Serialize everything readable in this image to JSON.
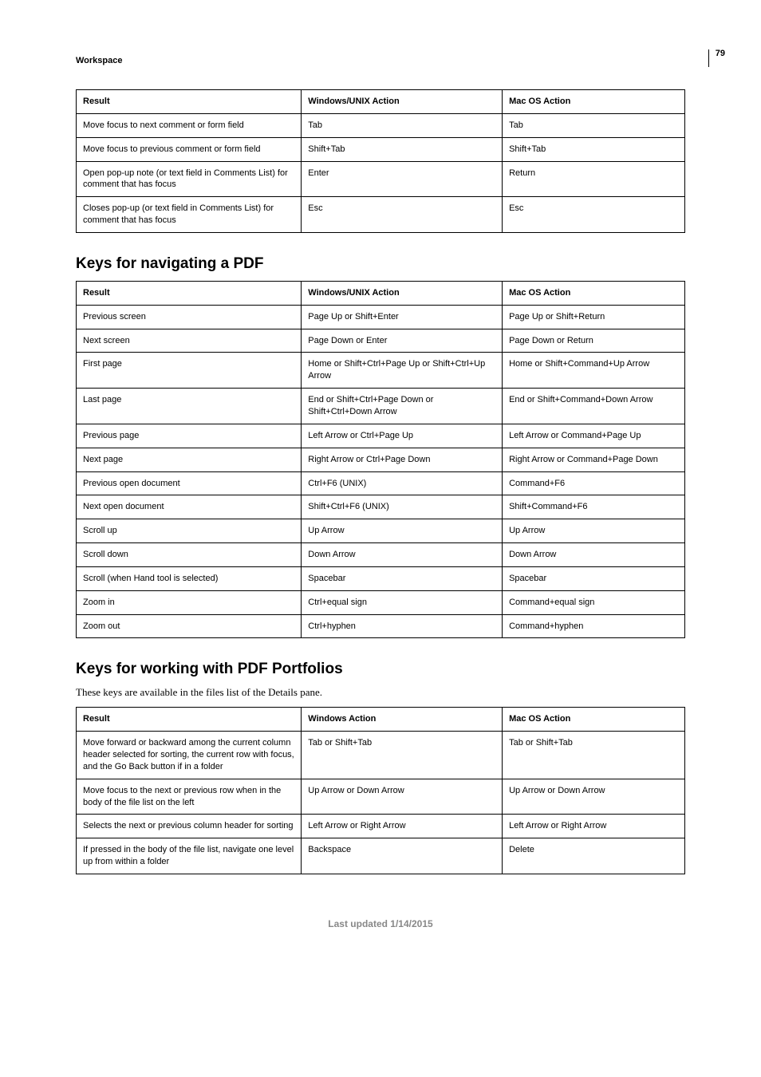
{
  "page_number": "79",
  "section_label": "Workspace",
  "table1": {
    "headers": [
      "Result",
      "Windows/UNIX Action",
      "Mac OS Action"
    ],
    "rows": [
      [
        "Move focus to next comment or form field",
        "Tab",
        "Tab"
      ],
      [
        "Move focus to previous comment or form field",
        "Shift+Tab",
        "Shift+Tab"
      ],
      [
        "Open pop-up note (or text field in Comments List) for comment that has focus",
        "Enter",
        "Return"
      ],
      [
        "Closes pop-up (or text field in Comments List) for comment that has focus",
        "Esc",
        "Esc"
      ]
    ]
  },
  "heading2": "Keys for navigating a PDF",
  "table2": {
    "headers": [
      "Result",
      "Windows/UNIX Action",
      "Mac OS Action"
    ],
    "rows": [
      [
        "Previous screen",
        "Page Up or Shift+Enter",
        "Page Up or Shift+Return"
      ],
      [
        "Next screen",
        "Page Down or Enter",
        "Page Down or Return"
      ],
      [
        "First page",
        "Home or Shift+Ctrl+Page Up or Shift+Ctrl+Up Arrow",
        "Home or Shift+Command+Up Arrow"
      ],
      [
        "Last page",
        "End or Shift+Ctrl+Page Down or Shift+Ctrl+Down Arrow",
        "End or Shift+Command+Down Arrow"
      ],
      [
        "Previous page",
        "Left Arrow or Ctrl+Page Up",
        "Left Arrow or Command+Page Up"
      ],
      [
        "Next page",
        "Right Arrow or Ctrl+Page Down",
        "Right Arrow or Command+Page Down"
      ],
      [
        "Previous open document",
        "Ctrl+F6 (UNIX)",
        "Command+F6"
      ],
      [
        "Next open document",
        "Shift+Ctrl+F6 (UNIX)",
        "Shift+Command+F6"
      ],
      [
        "Scroll up",
        "Up Arrow",
        "Up Arrow"
      ],
      [
        "Scroll down",
        "Down Arrow",
        "Down Arrow"
      ],
      [
        "Scroll (when Hand tool is selected)",
        "Spacebar",
        "Spacebar"
      ],
      [
        "Zoom in",
        "Ctrl+equal sign",
        "Command+equal sign"
      ],
      [
        "Zoom out",
        "Ctrl+hyphen",
        "Command+hyphen"
      ]
    ]
  },
  "heading3": "Keys for working with PDF Portfolios",
  "subtitle3": "These keys are available in the files list of the Details pane.",
  "table3": {
    "headers": [
      "Result",
      "Windows Action",
      "Mac OS Action"
    ],
    "rows": [
      [
        "Move forward or backward among the current column header selected for sorting, the current row with focus, and the Go Back button if in a folder",
        "Tab or Shift+Tab",
        "Tab or Shift+Tab"
      ],
      [
        "Move focus to the next or previous row when in the body of the file list on the left",
        "Up Arrow or Down Arrow",
        "Up Arrow or Down Arrow"
      ],
      [
        "Selects the next or previous column header for sorting",
        "Left Arrow or Right Arrow",
        "Left Arrow or Right Arrow"
      ],
      [
        "If pressed in the body of the file list, navigate one level up from within a folder",
        "Backspace",
        "Delete"
      ]
    ]
  },
  "footer": "Last updated 1/14/2015"
}
